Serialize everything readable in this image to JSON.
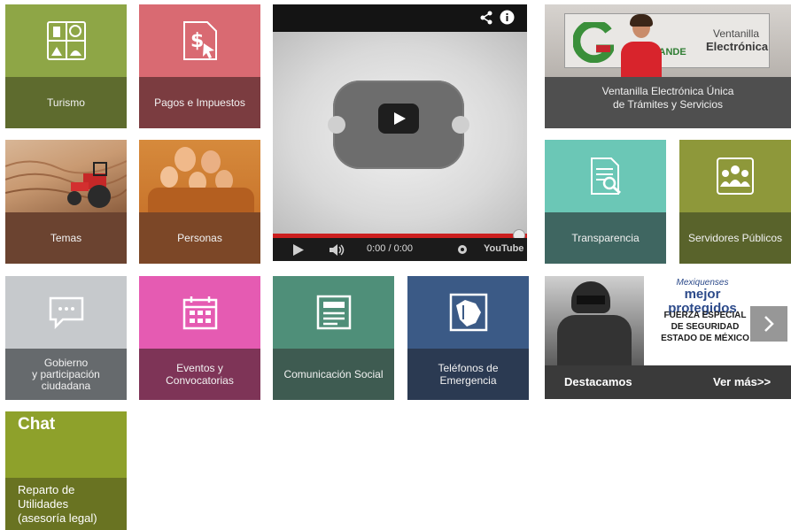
{
  "tiles": {
    "turismo": "Turismo",
    "pagos": "Pagos e Impuestos",
    "temas": "Temas",
    "personas": "Personas",
    "transparencia": "Transparencia",
    "servidores": "Servidores Públicos",
    "gobierno_l1": "Gobierno",
    "gobierno_l2": "y participación",
    "gobierno_l3": "ciudadana",
    "eventos_l1": "Eventos y",
    "eventos_l2": "Convocatorias",
    "comunicacion": "Comunicación Social",
    "telefonos_l1": "Teléfonos de",
    "telefonos_l2": "Emergencia"
  },
  "video": {
    "time": "0:00 / 0:00",
    "brand": "YouTube"
  },
  "ventanilla": {
    "banner_l1": "Ventanilla",
    "banner_l2": "Electrónica",
    "banner_logo_text": "GRANDE",
    "caption_l1": "Ventanilla Electrónica Única",
    "caption_l2": "de Trámites y Servicios"
  },
  "destacamos": {
    "headline_small": "Mexiquenses",
    "headline_big": "mejor protegidos",
    "line1": "FUERZA ESPECIAL",
    "line2": "DE SEGURIDAD",
    "line3": "ESTADO DE MÉXICO",
    "label": "Destacamos",
    "more": "Ver más>>"
  },
  "chat": {
    "title": "Chat",
    "line1": "Reparto de",
    "line2": "Utilidades",
    "line3": "(asesoría legal)"
  },
  "colors": {
    "turismo_top": "#8ea646",
    "turismo_bottom": "#5e6b2e",
    "pagos_top": "#d96a72",
    "pagos_bottom": "#7b3c40",
    "temas_bottom": "#6b4330",
    "personas_bottom": "#7c4727",
    "transparencia_top": "#6bc7b6",
    "transparencia_bottom": "#3f6661",
    "servidores_top": "#8e983a",
    "servidores_bottom": "#59632b",
    "gobierno_top": "#c6c9cc",
    "gobierno_bottom": "#666a6d",
    "eventos_top": "#e55bb2",
    "eventos_bottom": "#7e3457",
    "comunicacion_top": "#4f8f79",
    "comunicacion_bottom": "#3e5b51",
    "telefonos_top": "#3b5a86",
    "telefonos_bottom": "#2b3a52",
    "chat_top": "#8ea12b",
    "chat_bottom": "#697322"
  }
}
